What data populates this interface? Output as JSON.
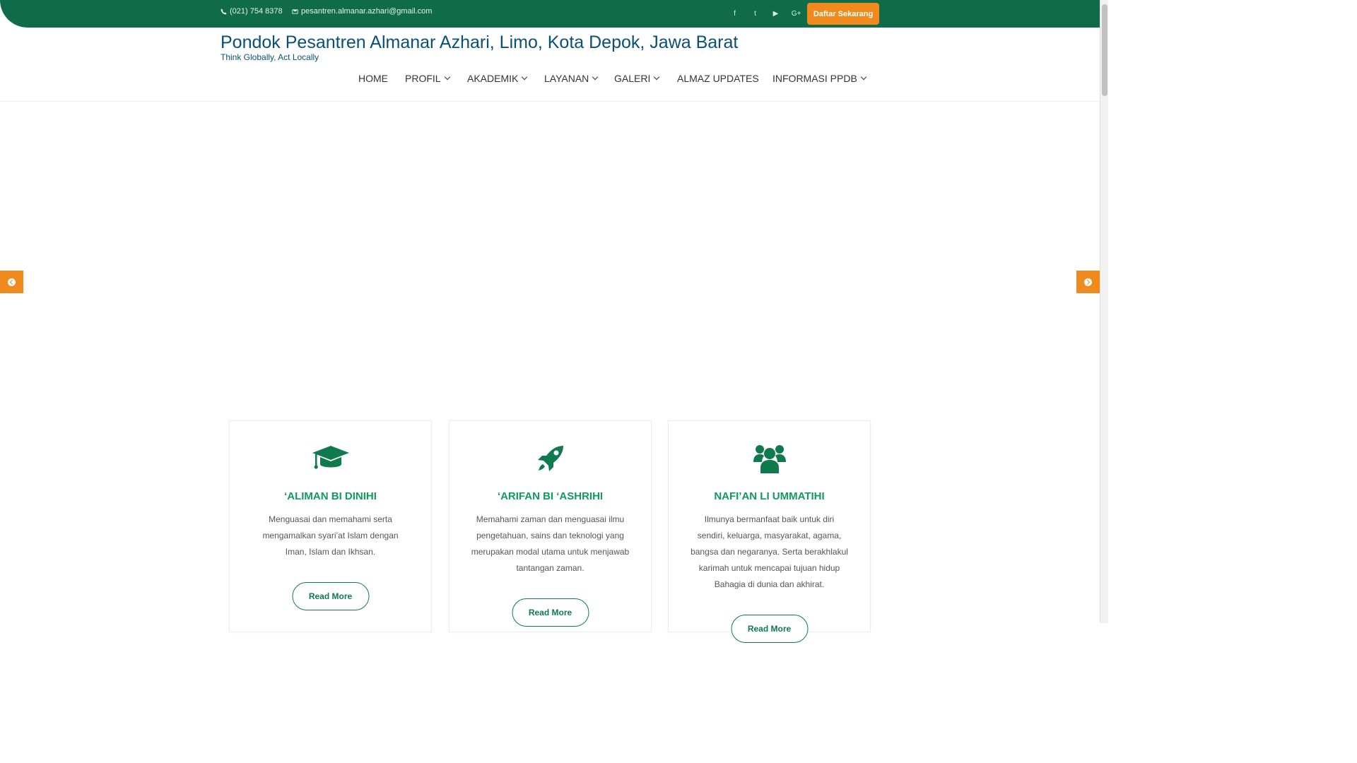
{
  "topbar": {
    "phone": "(021) 754 8378",
    "email": "pesantren.almanar.azhari@gmail.com",
    "social": [
      "facebook-icon",
      "twitter-icon",
      "youtube-icon",
      "google-plus-icon"
    ],
    "social_glyphs": [
      "f",
      "t",
      "▶",
      "G+"
    ],
    "cta_label": "Daftar Sekarang"
  },
  "header": {
    "title": "Pondok Pesantren Almanar Azhari, Limo, Kota Depok, Jawa Barat",
    "tagline": "Think Globally, Act Locally"
  },
  "nav": {
    "items": [
      {
        "label": "HOME",
        "dropdown": false
      },
      {
        "label": "PROFIL",
        "dropdown": true
      },
      {
        "label": "AKADEMIK",
        "dropdown": true
      },
      {
        "label": "LAYANAN",
        "dropdown": true
      },
      {
        "label": "GALERI",
        "dropdown": true
      },
      {
        "label": "ALMAZ UPDATES",
        "dropdown": false
      },
      {
        "label": "INFORMASI PPDB",
        "dropdown": true
      }
    ]
  },
  "cards": [
    {
      "icon": "graduation-cap-icon",
      "title": "‘ALIMAN BI DINIHI",
      "text": "Menguasai dan memahami serta mengamalkan syari’at Islam dengan Iman, Islam dan Ikhsan.",
      "button": "Read More"
    },
    {
      "icon": "rocket-icon",
      "title": "‘ARIFAN BI ‘ASHRIHI",
      "text": "Memahami zaman dan menguasai ilmu pengetahuan, sains dan teknologi yang merupakan modal utama untuk menjawab tantangan zaman.",
      "button": "Read More"
    },
    {
      "icon": "users-icon",
      "title": "NAFI’AN LI UMMATIHI",
      "text": "Ilmunya bermanfaat baik untuk diri sendiri, keluarga, masyarakat, agama, bangsa dan negaranya. Serta berakhlakul karimah untuk mencapai tujuan hidup Bahagia di dunia dan akhirat.",
      "button": "Read More"
    }
  ],
  "colors": {
    "topbar": "#0f6b48",
    "accent": "#f08a1c",
    "heading": "#0f9b5e",
    "title": "#0a4f77"
  }
}
